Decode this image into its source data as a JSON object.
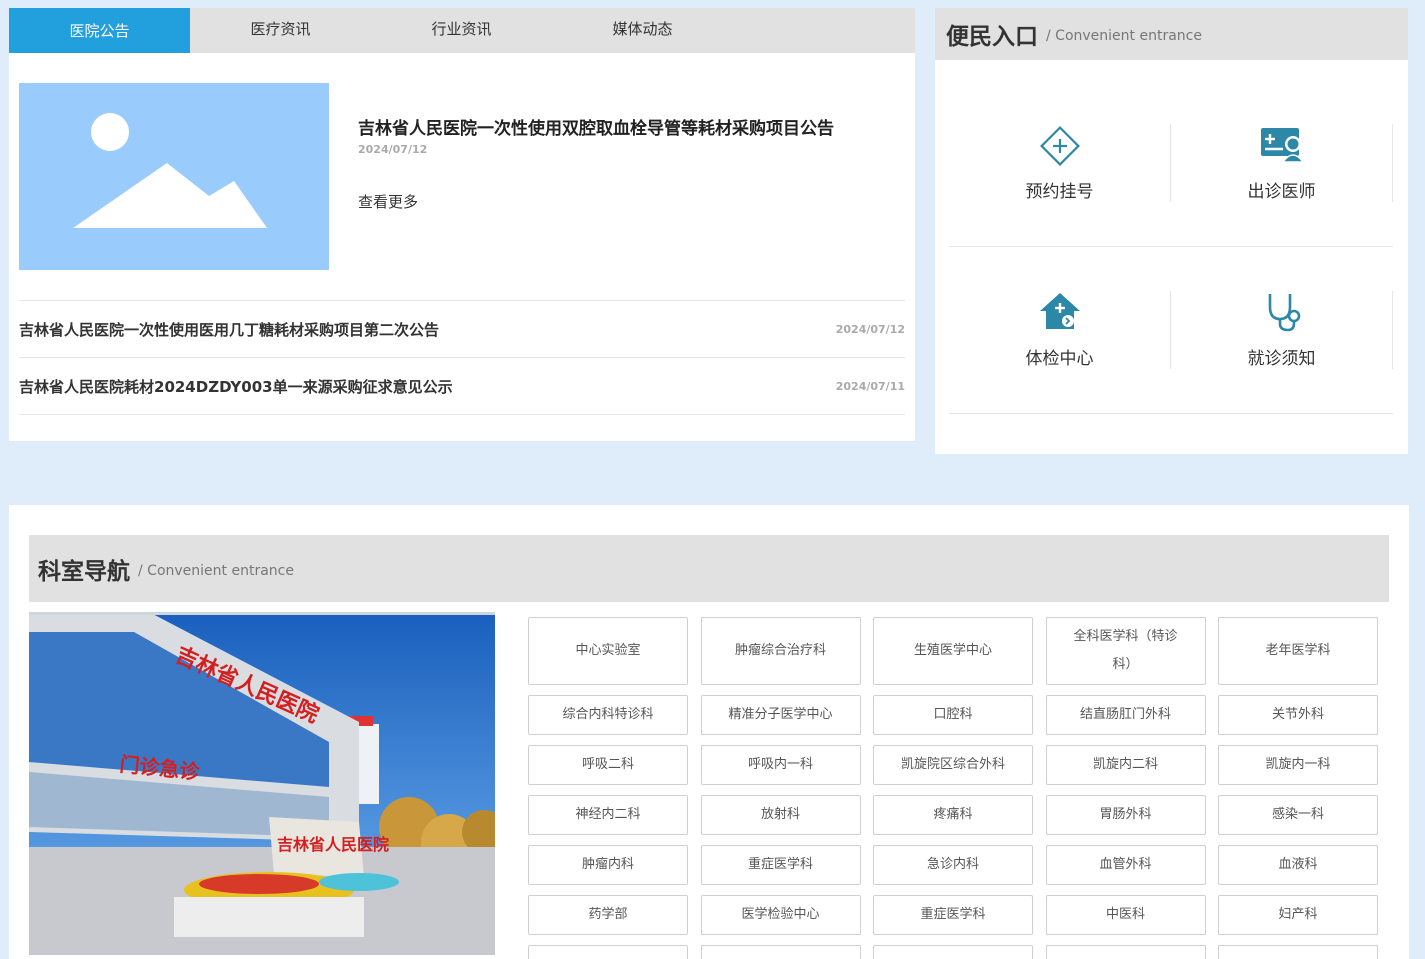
{
  "news": {
    "tabs": [
      "医院公告",
      "医疗资讯",
      "行业资讯",
      "媒体动态"
    ],
    "active_tab": 0,
    "featured": {
      "title": "吉林省人民医院一次性使用双腔取血栓导管等耗材采购项目公告",
      "date": "2024/07/12",
      "more": "查看更多"
    },
    "list": [
      {
        "title": "吉林省人民医院一次性使用医用几丁糖耗材采购项目第二次公告",
        "date": "2024/07/12"
      },
      {
        "title": "吉林省人民医院耗材2024DZDY003单一来源采购征求意见公示",
        "date": "2024/07/11"
      }
    ]
  },
  "convenient": {
    "title": "便民入口",
    "subtitle": "/ Convenient entrance",
    "items": [
      {
        "label": "预约挂号",
        "icon": "plus-diamond-icon"
      },
      {
        "label": "出诊医师",
        "icon": "doctor-card-icon"
      },
      {
        "label": "体检中心",
        "icon": "house-checkup-icon"
      },
      {
        "label": "就诊须知",
        "icon": "stethoscope-icon"
      }
    ],
    "icon_color": "#2d88a8"
  },
  "departments": {
    "title": "科室导航",
    "subtitle": "/ Convenient entrance",
    "items": [
      "中心实验室",
      "肿瘤综合治疗科",
      "生殖医学中心",
      "全科医学科（特诊科）",
      "老年医学科",
      "综合内科特诊科",
      "精准分子医学中心",
      "口腔科",
      "结直肠肛门外科",
      "关节外科",
      "呼吸二科",
      "呼吸内一科",
      "凯旋院区综合外科",
      "凯旋内二科",
      "凯旋内一科",
      "神经内二科",
      "放射科",
      "疼痛科",
      "胃肠外科",
      "感染一科",
      "肿瘤内科",
      "重症医学科",
      "急诊内科",
      "血管外科",
      "血液科",
      "药学部",
      "医学检验中心",
      "重症医学科",
      "中医科",
      "妇产科",
      "",
      "",
      "",
      "",
      ""
    ],
    "photo_sign": "吉林省人民医院",
    "photo_gate": "门诊急诊"
  }
}
